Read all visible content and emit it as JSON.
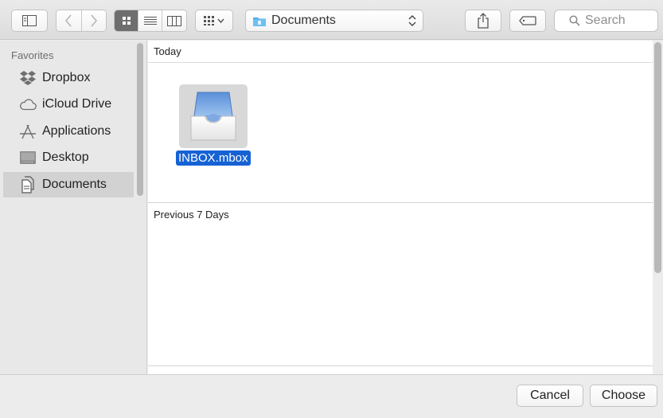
{
  "toolbar": {
    "path_label": "Documents",
    "search_placeholder": "Search"
  },
  "sidebar": {
    "heading": "Favorites",
    "items": [
      {
        "label": "Dropbox",
        "icon": "dropbox-icon"
      },
      {
        "label": "iCloud Drive",
        "icon": "cloud-icon"
      },
      {
        "label": "Applications",
        "icon": "applications-icon"
      },
      {
        "label": "Desktop",
        "icon": "desktop-icon"
      },
      {
        "label": "Documents",
        "icon": "documents-icon",
        "selected": true
      }
    ]
  },
  "content": {
    "groups": [
      {
        "title": "Today",
        "files": [
          {
            "name": "INBOX.mbox",
            "icon": "mailbox-icon",
            "selected": true
          }
        ]
      },
      {
        "title": "Previous 7 Days",
        "files": []
      }
    ]
  },
  "footer": {
    "cancel_label": "Cancel",
    "choose_label": "Choose"
  },
  "colors": {
    "selection": "#1662d4",
    "sidebar_selected": "#d2d2d2"
  }
}
